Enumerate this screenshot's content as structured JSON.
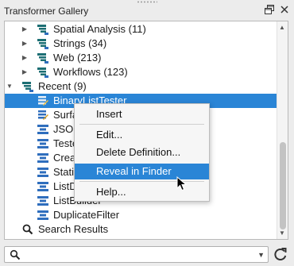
{
  "panel": {
    "title": "Transformer Gallery",
    "undock_icon": "undock-icon",
    "close_icon": "close-icon"
  },
  "tree": {
    "rows": [
      {
        "label": "Spatial Analysis (11)",
        "icon": "category-icon",
        "expander": "collapsed"
      },
      {
        "label": "Strings (34)",
        "icon": "category-icon",
        "expander": "collapsed"
      },
      {
        "label": "Web (213)",
        "icon": "category-icon",
        "expander": "collapsed"
      },
      {
        "label": "Workflows (123)",
        "icon": "category-icon",
        "expander": "collapsed"
      },
      {
        "label": "Recent (9)",
        "icon": "category-icon",
        "expander": "expanded"
      },
      {
        "label": "BinaryListTester",
        "icon": "custom-transformer-icon",
        "selected": true
      },
      {
        "label": "Surfa",
        "icon": "custom-transformer-icon"
      },
      {
        "label": "JSO",
        "icon": "transformer-icon"
      },
      {
        "label": "Teste",
        "icon": "transformer-icon"
      },
      {
        "label": "Crea",
        "icon": "transformer-icon"
      },
      {
        "label": "Stati",
        "icon": "transformer-icon"
      },
      {
        "label": "ListD",
        "icon": "transformer-icon"
      },
      {
        "label": "ListBuilder",
        "icon": "transformer-icon"
      },
      {
        "label": "DuplicateFilter",
        "icon": "transformer-icon"
      },
      {
        "label": "Search Results",
        "icon": "search-icon"
      }
    ]
  },
  "context_menu": {
    "items": [
      {
        "label": "Insert"
      },
      {
        "label": "Edit..."
      },
      {
        "label": "Delete Definition..."
      },
      {
        "label": "Reveal in Finder",
        "highlighted": true
      },
      {
        "label": "Help..."
      }
    ]
  },
  "search": {
    "value": "",
    "placeholder": ""
  },
  "colors": {
    "selection": "#2a85d6",
    "icon_teal": "#1d6f74",
    "icon_blue": "#2f6ebd"
  }
}
